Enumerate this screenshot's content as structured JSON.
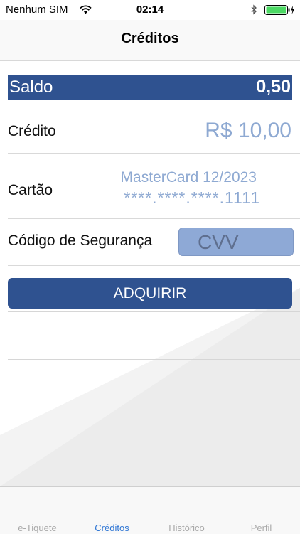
{
  "status_bar": {
    "carrier": "Nenhum SIM",
    "time": "02:14"
  },
  "nav": {
    "title": "Créditos"
  },
  "saldo": {
    "label": "Saldo",
    "value": "0,50"
  },
  "credito": {
    "label": "Crédito",
    "value": "R$ 10,00"
  },
  "cartao": {
    "label": "Cartão",
    "brand": "MasterCard 12/2023",
    "number": "****.****.****.1111"
  },
  "codigo": {
    "label": "Código de Segurança",
    "placeholder": "CVV"
  },
  "actions": {
    "buy_label": "ADQUIRIR"
  },
  "tabs": [
    {
      "label": "e-Tiquete",
      "active": false
    },
    {
      "label": "Créditos",
      "active": true
    },
    {
      "label": "Histórico",
      "active": false
    },
    {
      "label": "Perfil",
      "active": false
    }
  ],
  "colors": {
    "primary": "#2f5290",
    "muted_value": "#8ea9d2",
    "tab_active": "#2f76d4",
    "tab_inactive": "#a9a9a9"
  }
}
